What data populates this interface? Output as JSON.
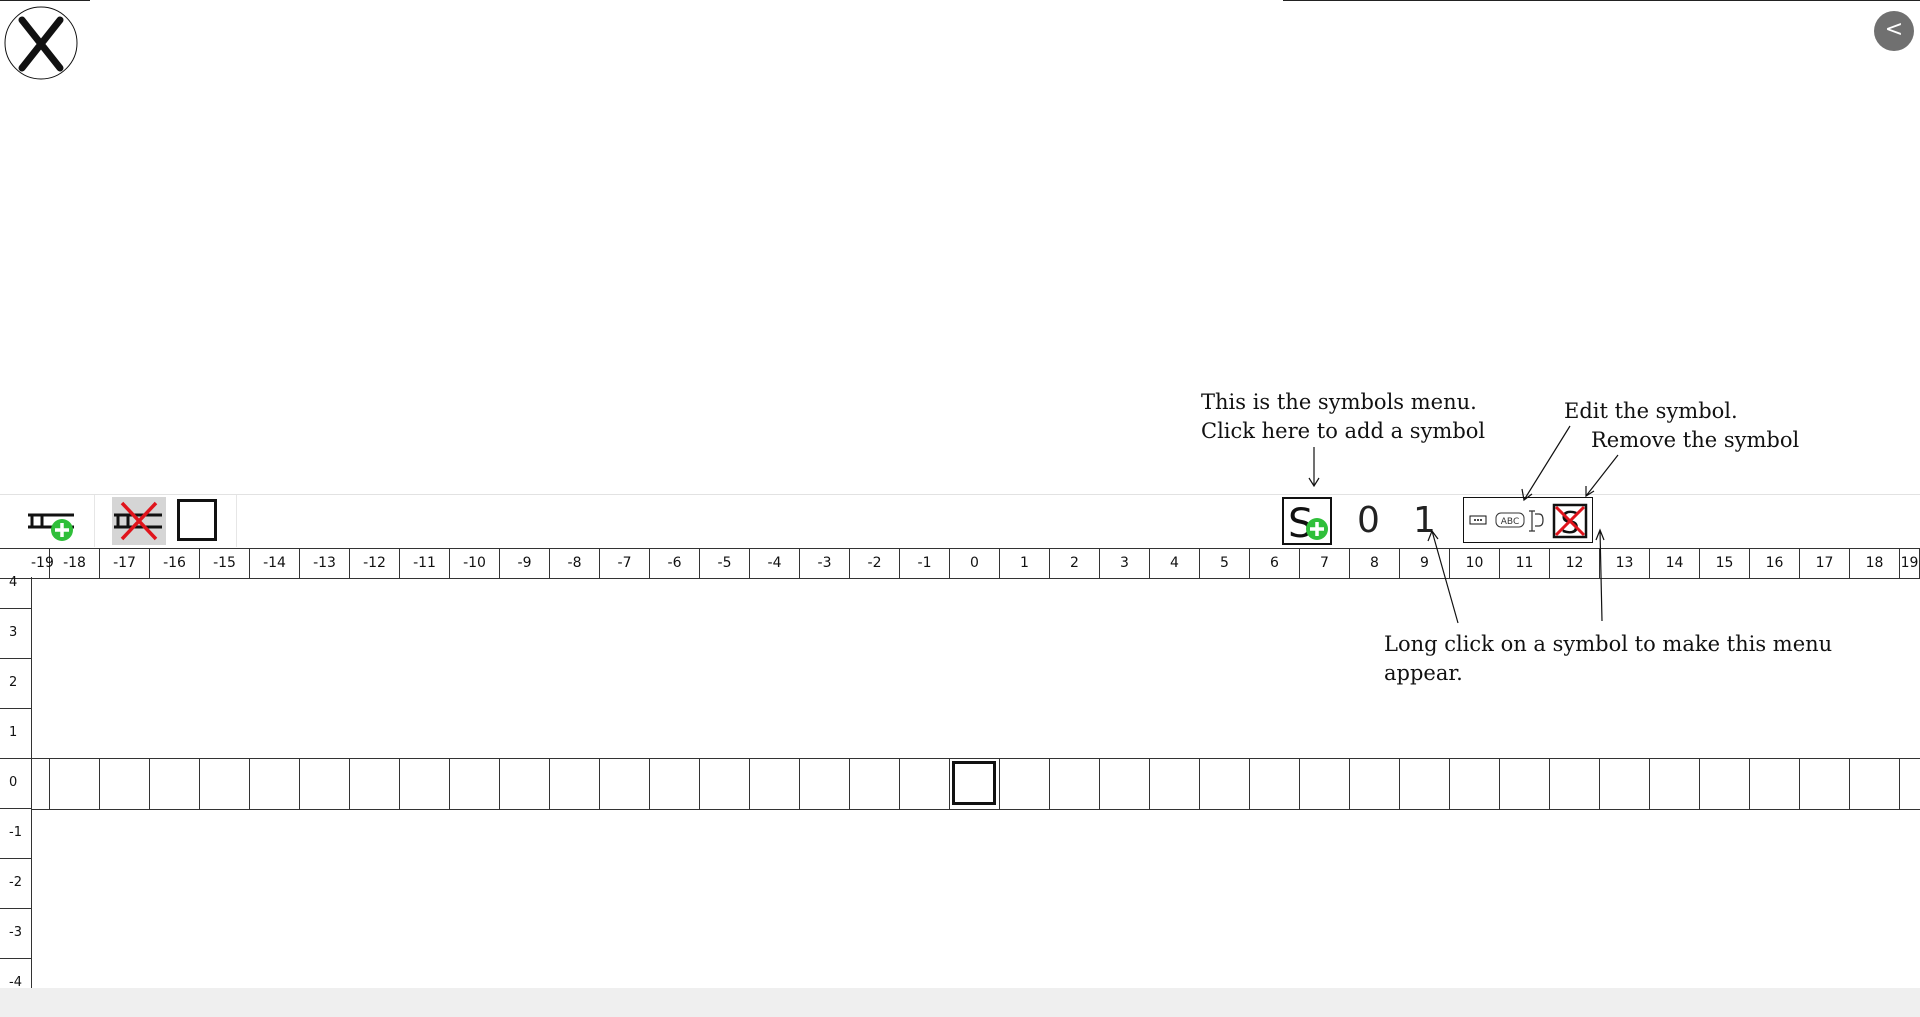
{
  "window": {
    "close_icon": "close-x-icon",
    "back_label": "<"
  },
  "annotations": {
    "symbols_menu_line1": "This is the symbols menu.",
    "symbols_menu_line2": "Click here to add a symbol",
    "edit_symbol": "Edit the symbol.",
    "remove_symbol": "Remove the symbol",
    "long_click_line1": "Long click on a symbol to make this menu",
    "long_click_line2": "appear."
  },
  "toolbar": {
    "add_tape_icon": "add-tape-icon",
    "remove_tape_icon": "remove-tape-icon",
    "blank_symbol_icon": "blank-symbol-icon",
    "add_symbol_icon": "add-symbol-icon",
    "symbols": [
      "0",
      "1"
    ],
    "symbol_menu": {
      "menu_icon": "menu-dots-icon",
      "edit_label": "ABC",
      "edit_icon": "edit-symbol-icon",
      "delete_icon": "delete-symbol-icon"
    }
  },
  "ruler": {
    "columns": [
      "-19",
      "-18",
      "-17",
      "-16",
      "-15",
      "-14",
      "-13",
      "-12",
      "-11",
      "-10",
      "-9",
      "-8",
      "-7",
      "-6",
      "-5",
      "-4",
      "-3",
      "-2",
      "-1",
      "0",
      "1",
      "2",
      "3",
      "4",
      "5",
      "6",
      "7",
      "8",
      "9",
      "10",
      "11",
      "12",
      "13",
      "14",
      "15",
      "16",
      "17",
      "18",
      "19"
    ]
  },
  "rows": {
    "labels": [
      "4",
      "3",
      "2",
      "1",
      "0",
      "-1",
      "-2",
      "-3",
      "-4"
    ]
  },
  "tape": {
    "head_position": "0",
    "head_symbol": "blank"
  },
  "colors": {
    "add_green": "#2fbf3a",
    "delete_red": "#e0141c",
    "back_button": "#707070"
  }
}
